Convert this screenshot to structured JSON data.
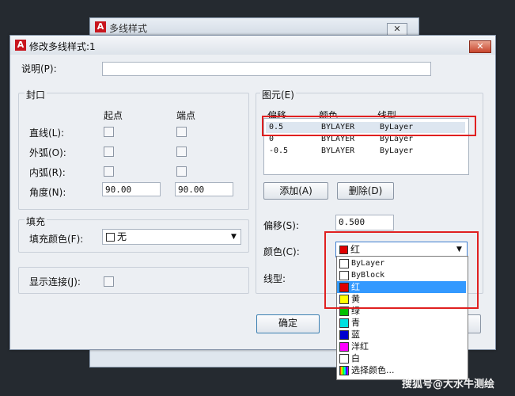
{
  "back_window": {
    "title": "多线样式",
    "close": "✕"
  },
  "dialog": {
    "title": "修改多线样式:1",
    "close": "✕"
  },
  "description": {
    "label": "说明(P):",
    "value": ""
  },
  "caps": {
    "section": "封口",
    "col_start": "起点",
    "col_end": "端点",
    "rows": [
      {
        "label": "直线(L):",
        "start_checked": false,
        "end_checked": false
      },
      {
        "label": "外弧(O):",
        "start_checked": false,
        "end_checked": false
      },
      {
        "label": "内弧(R):",
        "start_checked": false,
        "end_checked": false
      }
    ],
    "angle": {
      "label": "角度(N):",
      "start": "90.00",
      "end": "90.00"
    }
  },
  "fill": {
    "section": "填充",
    "color_label": "填充颜色(F):",
    "color_value": "无"
  },
  "joints": {
    "label": "显示连接(J):",
    "checked": false
  },
  "elements": {
    "section": "图元(E)",
    "headers": {
      "offset": "偏移",
      "color": "颜色",
      "linetype": "线型"
    },
    "rows": [
      {
        "offset": "0.5",
        "color": "BYLAYER",
        "linetype": "ByLayer",
        "selected": true
      },
      {
        "offset": "0",
        "color": "BYLAYER",
        "linetype": "ByLayer",
        "selected": false
      },
      {
        "offset": "-0.5",
        "color": "BYLAYER",
        "linetype": "ByLayer",
        "selected": false
      }
    ],
    "add_button": "添加(A)",
    "delete_button": "删除(D)",
    "offset_label": "偏移(S):",
    "offset_value": "0.500",
    "color_label": "颜色(C):",
    "color_value": "红",
    "linetype_label": "线型:"
  },
  "color_options": [
    {
      "label": "ByLayer",
      "color": "#ffffff"
    },
    {
      "label": "ByBlock",
      "color": "#ffffff"
    },
    {
      "label": "红",
      "color": "#e00000",
      "highlighted": true
    },
    {
      "label": "黄",
      "color": "#ffff00"
    },
    {
      "label": "绿",
      "color": "#00c000"
    },
    {
      "label": "青",
      "color": "#00e0e0"
    },
    {
      "label": "蓝",
      "color": "#0000d0"
    },
    {
      "label": "洋红",
      "color": "#ff00ff"
    },
    {
      "label": "白",
      "color": "#ffffff"
    },
    {
      "label": "选择颜色...",
      "color": "#888888"
    }
  ],
  "ok_button": "确定",
  "watermark": "搜狐号@大水牛测绘",
  "colors": {
    "highlight": "#3399ff",
    "annotation": "#e02020"
  }
}
